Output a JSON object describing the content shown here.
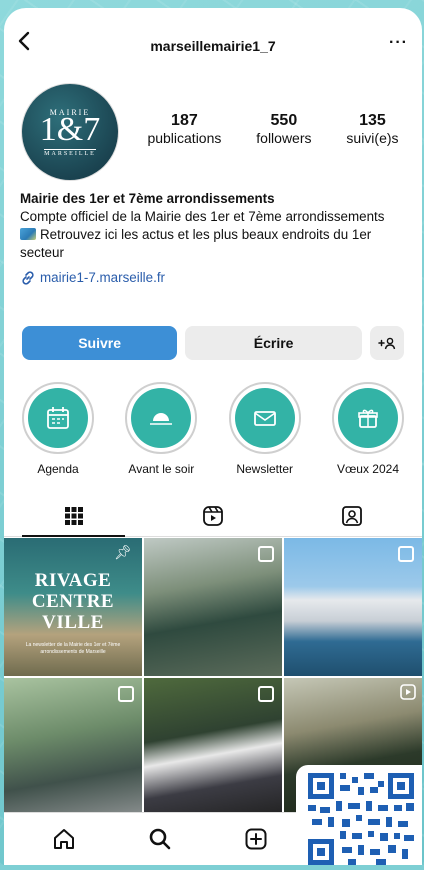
{
  "header": {
    "username": "marseillemairie1_7",
    "more": "···"
  },
  "avatar": {
    "line1": "MAIRIE",
    "line2": "1&7",
    "line3": "MARSEILLE"
  },
  "stats": [
    {
      "value": "187",
      "label": "publications"
    },
    {
      "value": "550",
      "label": "followers"
    },
    {
      "value": "135",
      "label": "suivi(e)s"
    }
  ],
  "bio": {
    "name": "Mairie des 1er et 7ème arrondissements",
    "description": "Compte officiel de la Mairie des 1er et 7ème arrondissements",
    "tagline": "Retrouvez ici les actus et les plus beaux endroits du 1er secteur",
    "link": "mairie1-7.marseille.fr"
  },
  "buttons": {
    "follow": "Suivre",
    "message": "Écrire",
    "add_user": "+ዲ"
  },
  "highlights": [
    {
      "label": "Agenda",
      "icon": "calendar-icon"
    },
    {
      "label": "Avant le soir",
      "icon": "sunset-icon"
    },
    {
      "label": "Newsletter",
      "icon": "envelope-icon"
    },
    {
      "label": "Vœux 2024",
      "icon": "gift-icon"
    }
  ],
  "tabs": [
    "grid-icon",
    "reels-icon",
    "tagged-icon"
  ],
  "posts": {
    "first_title": "RIVAGE\nCENTRE\nVILLE",
    "first_sub": "La newsletter de la Mairie des 1er et 7ème arrondissements de Marseille"
  },
  "nav": [
    "home-icon",
    "search-icon",
    "create-icon"
  ],
  "colors": {
    "accent": "#3d8fd6",
    "highlight": "#33b3a6",
    "link": "#2a5dab"
  }
}
